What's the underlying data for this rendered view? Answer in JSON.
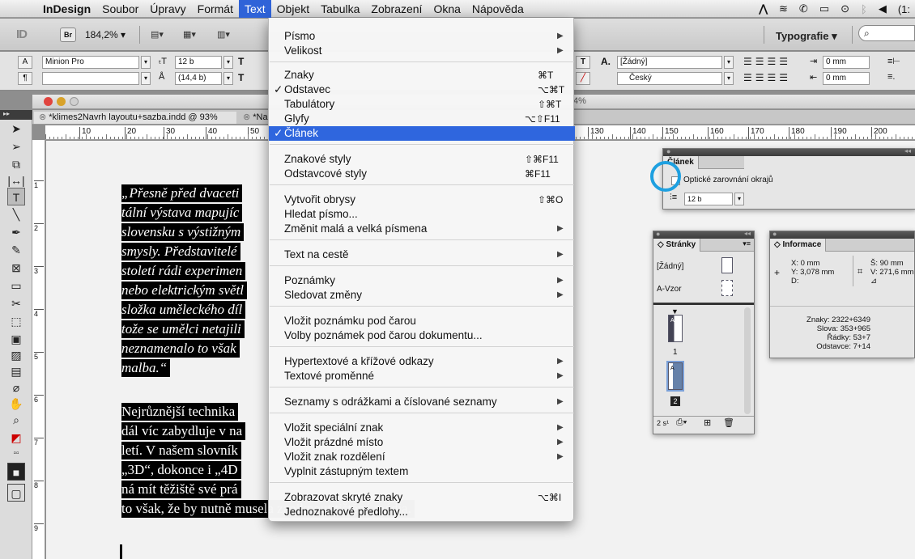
{
  "menubar": {
    "apple_glyph": "",
    "items": [
      "InDesign",
      "Soubor",
      "Úpravy",
      "Formát",
      "Text",
      "Objekt",
      "Tabulka",
      "Zobrazení",
      "Okna",
      "Nápověda"
    ],
    "active": "Text",
    "tray_clock": "(1:"
  },
  "appbar": {
    "logo": "ID",
    "bridge_label": "Br",
    "zoom": "184,2% ▾",
    "workspace": "Typografie ▾",
    "search_glyph": "⌕"
  },
  "control_panel": {
    "font_family": "Minion Pro",
    "font_size": "12 b",
    "leading": "(14,4 b)",
    "char_style": "[Žádný]",
    "language": "Český",
    "indent_left": "0 mm",
    "indent_first": "0 mm",
    "zoom_suffix": "4%"
  },
  "document": {
    "tabs": [
      "*klimes2Navrh layoutu+sazba.indd @ 93%",
      "*Na"
    ],
    "ruler_ticks": [
      "10",
      "20",
      "30",
      "40",
      "50",
      "130",
      "140",
      "150",
      "160",
      "170",
      "180",
      "190",
      "200"
    ],
    "vruler_ticks": [
      "1",
      "2",
      "3",
      "4",
      "5",
      "6",
      "7",
      "8",
      "9"
    ],
    "text_lines": [
      "„Přesně před dvaceti",
      "tální výstava mapujíc",
      "slovensku s výstižným",
      "smysly. Představitelé",
      "století rádi experimen",
      "nebo elektrickým světl",
      "složka uměleckého díl",
      "tože se umělci netajili",
      "neznamenalo to však",
      "malba.“",
      "Nejrůznější technika",
      "dál víc zabydluje v na",
      "letí. V našem slovník",
      "„3D“, dokonce i „4D",
      "ná mít těžiště své prá",
      "to však, že by nutně musela zaniknout tištěná média."
    ]
  },
  "text_menu": {
    "items": [
      {
        "label": "Písmo",
        "submenu": true
      },
      {
        "label": "Velikost",
        "submenu": true
      },
      {
        "label": "Znaky",
        "shortcut": "⌘T"
      },
      {
        "label": "Odstavec",
        "shortcut": "⌥⌘T",
        "checked": "✓"
      },
      {
        "label": "Tabulátory",
        "shortcut": "⇧⌘T"
      },
      {
        "label": "Glyfy",
        "shortcut": "⌥⇧F11"
      },
      {
        "label": "Článek",
        "checked": "✓",
        "highlighted": true
      },
      {
        "label": "Znakové styly",
        "shortcut": "⇧⌘F11"
      },
      {
        "label": "Odstavcové styly",
        "shortcut": "⌘F11"
      },
      {
        "label": "Vytvořit obrysy",
        "shortcut": "⇧⌘O"
      },
      {
        "label": "Hledat písmo..."
      },
      {
        "label": "Změnit malá a velká písmena",
        "submenu": true
      },
      {
        "label": "Text na cestě",
        "submenu": true
      },
      {
        "label": "Poznámky",
        "submenu": true
      },
      {
        "label": "Sledovat změny",
        "submenu": true
      },
      {
        "label": "Vložit poznámku pod čarou"
      },
      {
        "label": "Volby poznámek pod čarou dokumentu..."
      },
      {
        "label": "Hypertextové a křížové odkazy",
        "submenu": true
      },
      {
        "label": "Textové proměnné",
        "submenu": true
      },
      {
        "label": "Seznamy s odrážkami a číslované seznamy",
        "submenu": true
      },
      {
        "label": "Vložit speciální znak",
        "submenu": true
      },
      {
        "label": "Vložit prázdné místo",
        "submenu": true
      },
      {
        "label": "Vložit znak rozdělení",
        "submenu": true
      },
      {
        "label": "Vyplnit zástupným textem"
      },
      {
        "label": "Zobrazovat skryté znaky",
        "shortcut": "⌥⌘I"
      },
      {
        "label": "Jednoznakové předlohy..."
      }
    ]
  },
  "clanek_panel": {
    "tab": "Článek",
    "checkbox_label": "Optické zarovnání okrajů",
    "size_value": "12 b"
  },
  "stranky_panel": {
    "tab": "◇ Stránky",
    "none_master": "[Žádný]",
    "a_master": "A-Vzor",
    "page1": "1",
    "page2": "2",
    "footer": "2 s¹"
  },
  "info_panel": {
    "tab": "◇ Informace",
    "x": "X: 0 mm",
    "y": "Y: 3,078 mm",
    "d": "D:",
    "w": "Š: 90 mm",
    "v": "V: 271,6 mm",
    "znaky": "Znaky: 2322+6349",
    "slova": "Slova: 353+965",
    "radky": "Řádky: 53+7",
    "odstavce": "Odstavce: 7+14"
  },
  "colors": {
    "menu_highlight": "#2f66de",
    "focus_ring": "#1ea0e0"
  }
}
